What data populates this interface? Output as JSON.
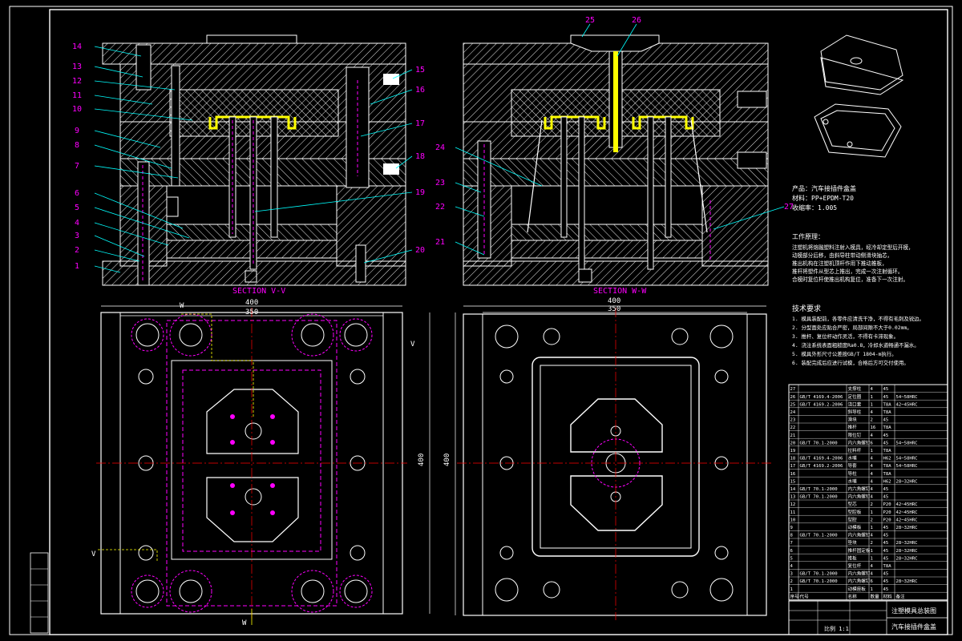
{
  "colors": {
    "background": "#000000",
    "line": "#ffffff",
    "hatch": "#ffffff",
    "leader": "#00ffff",
    "label": "#ff00ff",
    "hidden": "#ff00ff",
    "sprue": "#ffff00",
    "centerline": "#ff0000"
  },
  "section_left": {
    "caption": "SECTION V-V",
    "callouts": [
      "14",
      "13",
      "12",
      "11",
      "10",
      "9",
      "8",
      "7",
      "6",
      "5",
      "4",
      "3",
      "2",
      "1",
      "15",
      "16",
      "17",
      "18",
      "19",
      "20"
    ]
  },
  "section_right": {
    "caption": "SECTION W-W",
    "callouts": [
      "25",
      "26",
      "24",
      "23",
      "22",
      "21",
      "27"
    ]
  },
  "plan_left": {
    "dim_width": "400",
    "dim_inner": "350",
    "dim_height": "400",
    "cut_w": "W",
    "cut_v": "V"
  },
  "plan_right": {
    "dim_width": "400",
    "dim_inner": "350",
    "dim_height": "400"
  },
  "product_info": {
    "product": "产品：汽车接插件盒盖",
    "material": "材料：PP+EPDM-T20",
    "shrinkage": "收缩率：1.005"
  },
  "work_notes": {
    "heading": "工作原理：",
    "lines": [
      "注塑机将熔融塑料注射入模具，经冷却定型后开模，",
      "动模部分后移，由斜导柱带动侧滑块抽芯，",
      "推出机构在注塑机顶杆作用下推动推板，",
      "推杆将塑件从型芯上推出，完成一次注射循环。",
      "合模时复位杆使推出机构复位，准备下一次注射。"
    ]
  },
  "tech_req": {
    "heading": "技术要求",
    "lines": [
      "1. 模具装配前，各零件应清洗干净，不得有毛刺及锐边。",
      "2. 分型面处应贴合严密，局部间隙不大于0.02mm。",
      "3. 推杆、复位杆动作灵活，不得有卡滞现象。",
      "4. 浇注系统表面粗糙度Ra0.8，冷却水道畅通不漏水。",
      "5. 模具外形尺寸公差按GB/T 1804-m执行。",
      "6. 装配完成后应进行试模，合格后方可交付使用。"
    ]
  },
  "bom_rows": [
    {
      "no": "27",
      "code": "",
      "name": "支撑柱",
      "qty": "4",
      "mat": "45",
      "note": ""
    },
    {
      "no": "26",
      "code": "GB/T 4169.4-2006",
      "name": "定位圈",
      "qty": "1",
      "mat": "45",
      "note": "54~58HRC"
    },
    {
      "no": "25",
      "code": "GB/T 4169.2-2006",
      "name": "浇口套",
      "qty": "1",
      "mat": "T8A",
      "note": "42~45HRC"
    },
    {
      "no": "24",
      "code": "",
      "name": "斜导柱",
      "qty": "4",
      "mat": "T8A",
      "note": ""
    },
    {
      "no": "23",
      "code": "",
      "name": "滑块",
      "qty": "2",
      "mat": "45",
      "note": ""
    },
    {
      "no": "22",
      "code": "",
      "name": "推杆",
      "qty": "16",
      "mat": "T8A",
      "note": ""
    },
    {
      "no": "21",
      "code": "",
      "name": "限位钉",
      "qty": "4",
      "mat": "45",
      "note": ""
    },
    {
      "no": "20",
      "code": "GB/T 70.1-2000",
      "name": "内六角螺钉",
      "qty": "6",
      "mat": "45",
      "note": "54~58HRC"
    },
    {
      "no": "19",
      "code": "",
      "name": "拉料杆",
      "qty": "1",
      "mat": "T8A",
      "note": ""
    },
    {
      "no": "18",
      "code": "GB/T 4169.4-2006",
      "name": "水嘴",
      "qty": "4",
      "mat": "H62",
      "note": "54~58HRC"
    },
    {
      "no": "17",
      "code": "GB/T 4169.2-2006",
      "name": "导套",
      "qty": "4",
      "mat": "T8A",
      "note": "54~58HRC"
    },
    {
      "no": "16",
      "code": "",
      "name": "导柱",
      "qty": "4",
      "mat": "T8A",
      "note": ""
    },
    {
      "no": "15",
      "code": "",
      "name": "水嘴",
      "qty": "4",
      "mat": "H62",
      "note": "28~32HRC"
    },
    {
      "no": "14",
      "code": "GB/T 70.1-2000",
      "name": "内六角螺钉",
      "qty": "4",
      "mat": "45",
      "note": ""
    },
    {
      "no": "13",
      "code": "GB/T 70.1-2000",
      "name": "内六角螺钉",
      "qty": "4",
      "mat": "45",
      "note": ""
    },
    {
      "no": "12",
      "code": "",
      "name": "型芯",
      "qty": "2",
      "mat": "P20",
      "note": "42~45HRC"
    },
    {
      "no": "11",
      "code": "",
      "name": "型腔板",
      "qty": "1",
      "mat": "P20",
      "note": "42~45HRC"
    },
    {
      "no": "10",
      "code": "",
      "name": "型腔",
      "qty": "2",
      "mat": "P20",
      "note": "42~45HRC"
    },
    {
      "no": "9",
      "code": "",
      "name": "动模板",
      "qty": "1",
      "mat": "45",
      "note": "28~32HRC"
    },
    {
      "no": "8",
      "code": "GB/T 70.1-2000",
      "name": "内六角螺钉",
      "qty": "4",
      "mat": "45",
      "note": ""
    },
    {
      "no": "7",
      "code": "",
      "name": "垫块",
      "qty": "2",
      "mat": "45",
      "note": "28~32HRC"
    },
    {
      "no": "6",
      "code": "",
      "name": "推杆固定板",
      "qty": "1",
      "mat": "45",
      "note": "28~32HRC"
    },
    {
      "no": "5",
      "code": "",
      "name": "推板",
      "qty": "1",
      "mat": "45",
      "note": "28~32HRC"
    },
    {
      "no": "4",
      "code": "",
      "name": "复位杆",
      "qty": "4",
      "mat": "T8A",
      "note": ""
    },
    {
      "no": "3",
      "code": "GB/T 70.1-2000",
      "name": "内六角螺钉",
      "qty": "4",
      "mat": "45",
      "note": ""
    },
    {
      "no": "2",
      "code": "GB/T 70.1-2000",
      "name": "内六角螺钉",
      "qty": "6",
      "mat": "45",
      "note": "28~32HRC"
    },
    {
      "no": "1",
      "code": "",
      "name": "动模座板",
      "qty": "1",
      "mat": "45",
      "note": ""
    }
  ],
  "bom_header": {
    "no": "序号",
    "code": "代号",
    "name": "名称",
    "qty": "数量",
    "mat": "材料",
    "note": "备注"
  },
  "title_block": {
    "drawing_title": "注塑模具总装图",
    "part_name": "汽车接插件盒盖",
    "scale_label": "比例 1:1"
  }
}
